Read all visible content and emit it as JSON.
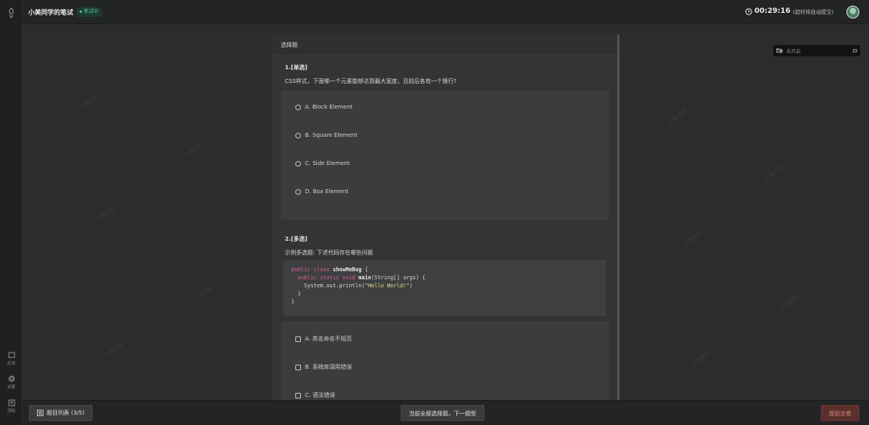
{
  "header": {
    "title": "小美同学的笔试",
    "status": "笔试中",
    "timer": "00:29:16",
    "timer_note": "(超时将自动提交)"
  },
  "rail": {
    "items": [
      {
        "label": "反馈",
        "icon": "feedback-icon"
      },
      {
        "label": "设置",
        "icon": "gear-icon"
      },
      {
        "label": "须知",
        "icon": "notice-icon"
      }
    ]
  },
  "camera": {
    "label": "未开启"
  },
  "panel": {
    "section_title": "选择题",
    "q1": {
      "num": "1.[单选]",
      "text": "CSS样式，下面哪一个元素能够达到最大宽度，且前后各有一个换行?",
      "options": [
        "A. Block Element",
        "B. Square Element",
        "C. Side Element",
        "D. Box Element"
      ]
    },
    "q2": {
      "num": "2.[多选]",
      "text": "示例多选题: 下述代码存在哪些问题",
      "code": {
        "l1_kw": "public class ",
        "l1_name": "showMeBug",
        "l1_tail": " {",
        "l2_kw": "  public static void ",
        "l2_name": "main",
        "l2_tail": "(String[] args) {",
        "l3": "    System.out.println(",
        "l3_str": "\"Hello World!\"",
        "l3_tail": ")",
        "l4": "  }",
        "l5": "}"
      },
      "options": [
        "A. 类名命名不规范",
        "B. 系统库调用错误",
        "C. 语法错误"
      ]
    }
  },
  "footer": {
    "list_label": "题目列表 (3/5)",
    "next_label": "当前全部选择题，下一题型",
    "submit_label": "提前交卷"
  },
  "watermark": "小美同学"
}
